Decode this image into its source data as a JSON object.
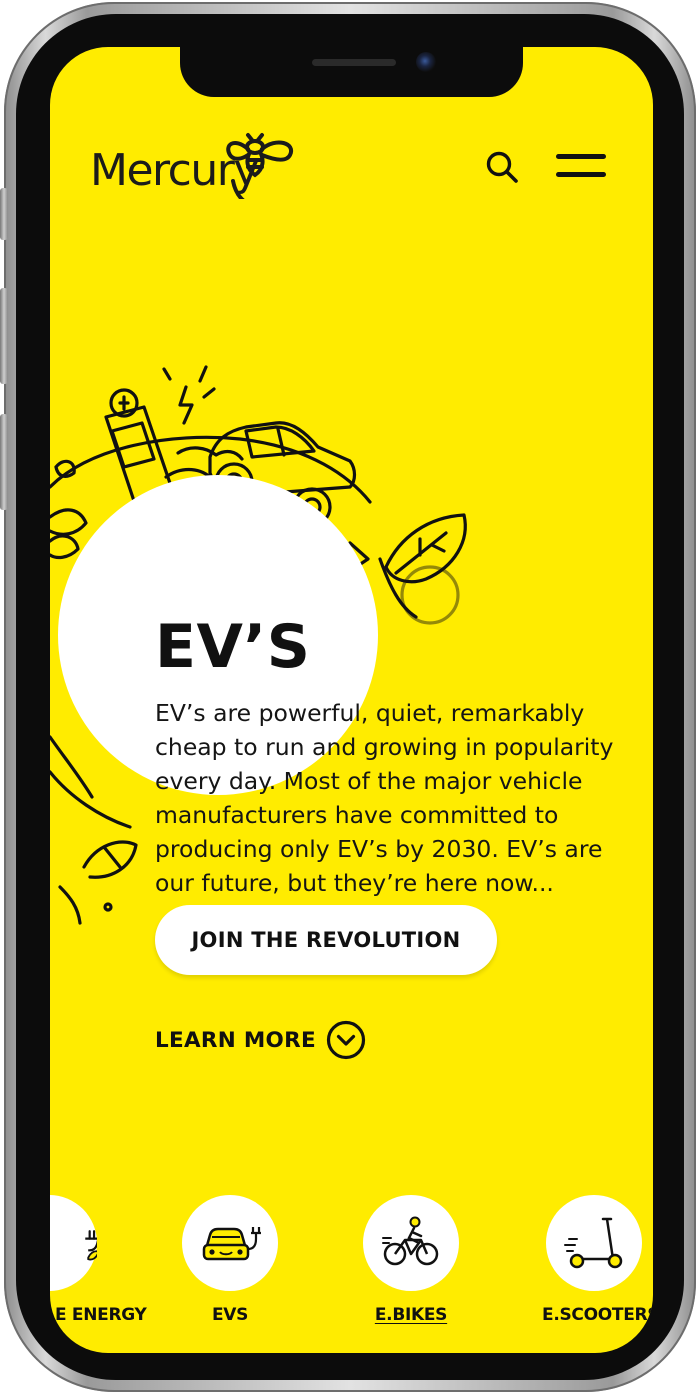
{
  "header": {
    "logo_text": "Mercury",
    "search_icon": "search-icon",
    "menu_icon": "hamburger-menu-icon"
  },
  "hero": {
    "title": "EV’S",
    "description": "EV’s are powerful, quiet, remarkably cheap to run and growing in popularity every day. Most of the major vehicle manufacturers have committed to producing only EV’s by 2030. EV’s are our future, but they’re here now...",
    "cta_label": "JOIN THE REVOLUTION",
    "learn_more_label": "LEARN MORE"
  },
  "categories": [
    {
      "label": "E ENERGY",
      "icon": "plug-leaf-icon",
      "active": false
    },
    {
      "label": "EVS",
      "icon": "ev-car-icon",
      "active": false
    },
    {
      "label": "E.BIKES",
      "icon": "ebike-icon",
      "active": true
    },
    {
      "label": "E.SCOOTERS",
      "icon": "escooter-icon",
      "active": false
    }
  ],
  "colors": {
    "brand_yellow": "#ffec00",
    "text_dark": "#111111",
    "white": "#ffffff"
  }
}
